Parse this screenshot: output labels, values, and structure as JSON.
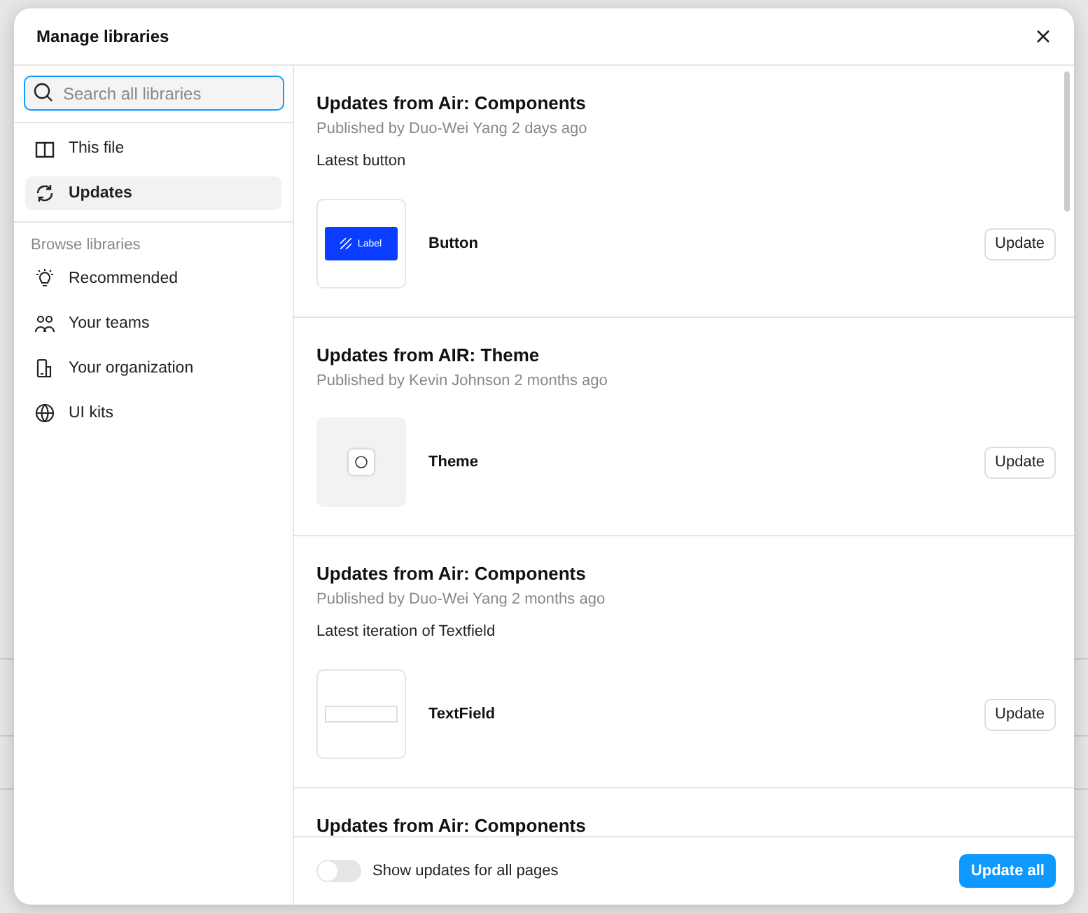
{
  "dialog": {
    "title": "Manage libraries"
  },
  "sidebar": {
    "search": {
      "placeholder": "Search all libraries"
    },
    "items": [
      {
        "kind": "book",
        "label": "This file",
        "selected": false
      },
      {
        "kind": "refresh",
        "label": "Updates",
        "selected": true
      }
    ],
    "browse_heading": "Browse libraries",
    "browse_items": [
      {
        "kind": "bulb",
        "label": "Recommended",
        "selected": false
      },
      {
        "kind": "people",
        "label": "Your teams",
        "selected": false
      },
      {
        "kind": "building",
        "label": "Your organization",
        "selected": false
      },
      {
        "kind": "globe",
        "label": "UI kits",
        "selected": false
      }
    ]
  },
  "updates": [
    {
      "title": "Updates from Air: Components",
      "published": "Published by Duo-Wei Yang 2 days ago",
      "description": "Latest button",
      "component": {
        "kind": "button",
        "preview_label": "Label",
        "name": "Button"
      },
      "action": "Update"
    },
    {
      "title": "Updates from AIR: Theme",
      "published": "Published by Kevin Johnson 2 months ago",
      "component": {
        "kind": "theme",
        "name": "Theme"
      },
      "action": "Update"
    },
    {
      "title": "Updates from Air: Components",
      "published": "Published by Duo-Wei Yang 2 months ago",
      "description": "Latest iteration of Textfield",
      "component": {
        "kind": "textfield",
        "name": "TextField"
      },
      "action": "Update"
    },
    {
      "title": "Updates from Air: Components"
    }
  ],
  "footer": {
    "toggle": {
      "label": "Show updates for all pages",
      "on": false
    },
    "button": "Update all"
  }
}
